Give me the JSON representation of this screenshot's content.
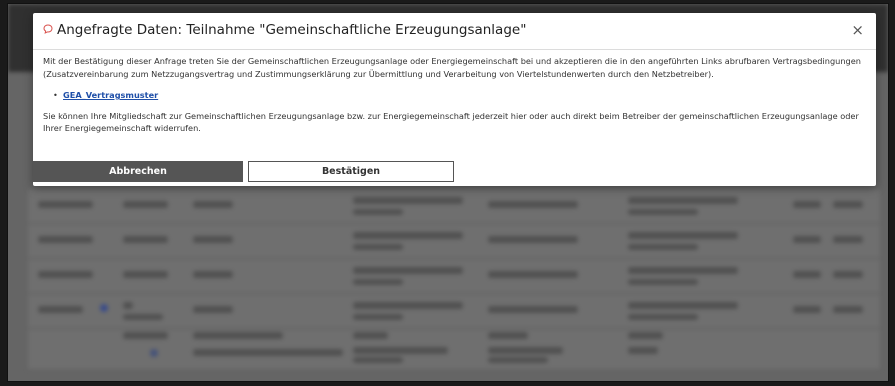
{
  "modal": {
    "title": "Angefragte Daten: Teilnahme \"Gemeinschaftliche Erzeugungsanlage\"",
    "close_symbol": "×",
    "paragraph1": "Mit der Bestätigung dieser Anfrage treten Sie der Gemeinschaftlichen Erzeugungsanlage oder Energiegemeinschaft bei und akzeptieren die in den angeführten Links abrufbaren Vertragsbedingungen (Zusatzvereinbarung zum Netzzugangsvertrag und Zustimmungserklärung zur Übermittlung und Verarbeitung von Viertelstundenwerten durch den Netzbetreiber).",
    "links": [
      "GEA_Vertragsmuster"
    ],
    "paragraph2": "Sie können Ihre Mitgliedschaft zur Gemeinschaftlichen Erzeugungsanlage bzw. zur Energiegemeinschaft jederzeit hier oder auch direkt beim Betreiber der gemeinschaftlichen Erzeugungsanlage oder Ihrer Energiegemeinschaft widerrufen.",
    "cancel_label": "Abbrechen",
    "confirm_label": "Bestätigen",
    "title_icon": "chat-bubble-icon",
    "accent_color": "#d9534f"
  }
}
